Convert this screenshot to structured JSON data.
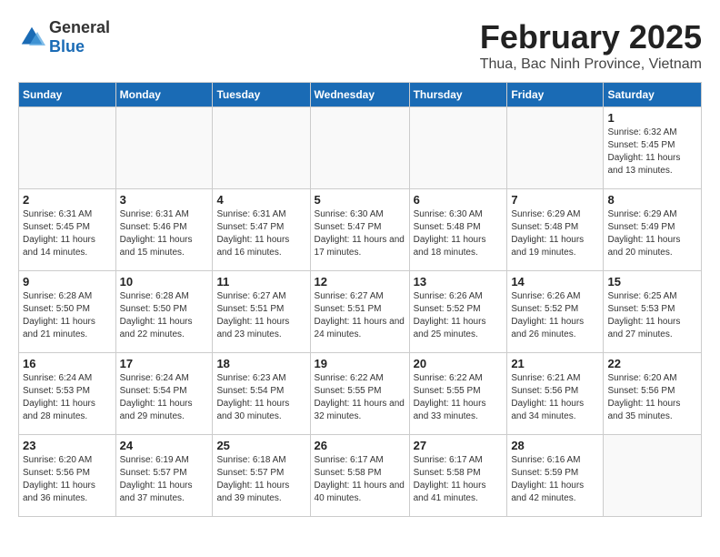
{
  "logo": {
    "general": "General",
    "blue": "Blue"
  },
  "title": {
    "month": "February 2025",
    "location": "Thua, Bac Ninh Province, Vietnam"
  },
  "headers": [
    "Sunday",
    "Monday",
    "Tuesday",
    "Wednesday",
    "Thursday",
    "Friday",
    "Saturday"
  ],
  "weeks": [
    [
      {
        "day": "",
        "info": ""
      },
      {
        "day": "",
        "info": ""
      },
      {
        "day": "",
        "info": ""
      },
      {
        "day": "",
        "info": ""
      },
      {
        "day": "",
        "info": ""
      },
      {
        "day": "",
        "info": ""
      },
      {
        "day": "1",
        "info": "Sunrise: 6:32 AM\nSunset: 5:45 PM\nDaylight: 11 hours and 13 minutes."
      }
    ],
    [
      {
        "day": "2",
        "info": "Sunrise: 6:31 AM\nSunset: 5:45 PM\nDaylight: 11 hours and 14 minutes."
      },
      {
        "day": "3",
        "info": "Sunrise: 6:31 AM\nSunset: 5:46 PM\nDaylight: 11 hours and 15 minutes."
      },
      {
        "day": "4",
        "info": "Sunrise: 6:31 AM\nSunset: 5:47 PM\nDaylight: 11 hours and 16 minutes."
      },
      {
        "day": "5",
        "info": "Sunrise: 6:30 AM\nSunset: 5:47 PM\nDaylight: 11 hours and 17 minutes."
      },
      {
        "day": "6",
        "info": "Sunrise: 6:30 AM\nSunset: 5:48 PM\nDaylight: 11 hours and 18 minutes."
      },
      {
        "day": "7",
        "info": "Sunrise: 6:29 AM\nSunset: 5:48 PM\nDaylight: 11 hours and 19 minutes."
      },
      {
        "day": "8",
        "info": "Sunrise: 6:29 AM\nSunset: 5:49 PM\nDaylight: 11 hours and 20 minutes."
      }
    ],
    [
      {
        "day": "9",
        "info": "Sunrise: 6:28 AM\nSunset: 5:50 PM\nDaylight: 11 hours and 21 minutes."
      },
      {
        "day": "10",
        "info": "Sunrise: 6:28 AM\nSunset: 5:50 PM\nDaylight: 11 hours and 22 minutes."
      },
      {
        "day": "11",
        "info": "Sunrise: 6:27 AM\nSunset: 5:51 PM\nDaylight: 11 hours and 23 minutes."
      },
      {
        "day": "12",
        "info": "Sunrise: 6:27 AM\nSunset: 5:51 PM\nDaylight: 11 hours and 24 minutes."
      },
      {
        "day": "13",
        "info": "Sunrise: 6:26 AM\nSunset: 5:52 PM\nDaylight: 11 hours and 25 minutes."
      },
      {
        "day": "14",
        "info": "Sunrise: 6:26 AM\nSunset: 5:52 PM\nDaylight: 11 hours and 26 minutes."
      },
      {
        "day": "15",
        "info": "Sunrise: 6:25 AM\nSunset: 5:53 PM\nDaylight: 11 hours and 27 minutes."
      }
    ],
    [
      {
        "day": "16",
        "info": "Sunrise: 6:24 AM\nSunset: 5:53 PM\nDaylight: 11 hours and 28 minutes."
      },
      {
        "day": "17",
        "info": "Sunrise: 6:24 AM\nSunset: 5:54 PM\nDaylight: 11 hours and 29 minutes."
      },
      {
        "day": "18",
        "info": "Sunrise: 6:23 AM\nSunset: 5:54 PM\nDaylight: 11 hours and 30 minutes."
      },
      {
        "day": "19",
        "info": "Sunrise: 6:22 AM\nSunset: 5:55 PM\nDaylight: 11 hours and 32 minutes."
      },
      {
        "day": "20",
        "info": "Sunrise: 6:22 AM\nSunset: 5:55 PM\nDaylight: 11 hours and 33 minutes."
      },
      {
        "day": "21",
        "info": "Sunrise: 6:21 AM\nSunset: 5:56 PM\nDaylight: 11 hours and 34 minutes."
      },
      {
        "day": "22",
        "info": "Sunrise: 6:20 AM\nSunset: 5:56 PM\nDaylight: 11 hours and 35 minutes."
      }
    ],
    [
      {
        "day": "23",
        "info": "Sunrise: 6:20 AM\nSunset: 5:56 PM\nDaylight: 11 hours and 36 minutes."
      },
      {
        "day": "24",
        "info": "Sunrise: 6:19 AM\nSunset: 5:57 PM\nDaylight: 11 hours and 37 minutes."
      },
      {
        "day": "25",
        "info": "Sunrise: 6:18 AM\nSunset: 5:57 PM\nDaylight: 11 hours and 39 minutes."
      },
      {
        "day": "26",
        "info": "Sunrise: 6:17 AM\nSunset: 5:58 PM\nDaylight: 11 hours and 40 minutes."
      },
      {
        "day": "27",
        "info": "Sunrise: 6:17 AM\nSunset: 5:58 PM\nDaylight: 11 hours and 41 minutes."
      },
      {
        "day": "28",
        "info": "Sunrise: 6:16 AM\nSunset: 5:59 PM\nDaylight: 11 hours and 42 minutes."
      },
      {
        "day": "",
        "info": ""
      }
    ]
  ]
}
